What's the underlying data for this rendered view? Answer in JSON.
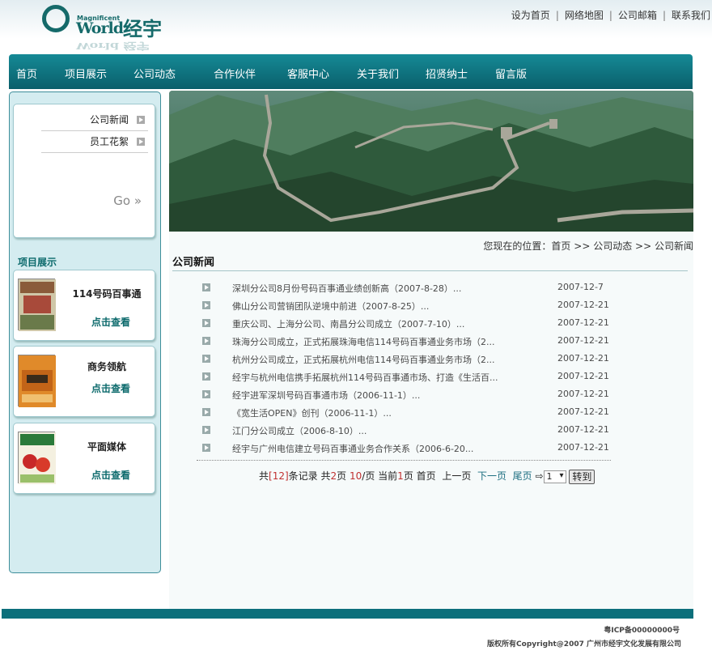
{
  "logo": {
    "small": "Magnificent",
    "world": "World",
    "cn": "经宇",
    "reflect": "World 经宇"
  },
  "toplinks": [
    "设为首页",
    "网络地图",
    "公司邮箱",
    "联系我们"
  ],
  "nav": [
    "首页",
    "项目展示",
    "公司动态",
    "合作伙伴",
    "客服中心",
    "关于我们",
    "招贤纳士",
    "留言版"
  ],
  "sidebar": {
    "subnav": [
      "公司新闻",
      "员工花絮"
    ],
    "go": "Go »",
    "title": "项目展示",
    "cards": [
      {
        "title": "114号码百事通",
        "link": "点击查看"
      },
      {
        "title": "商务领航",
        "link": "点击查看"
      },
      {
        "title": "平面媒体",
        "link": "点击查看"
      }
    ]
  },
  "breadcrumb": {
    "prefix": "您现在的位置：",
    "items": [
      "首页",
      "公司动态",
      "公司新闻"
    ],
    "sep": ">>"
  },
  "section_title": "公司新闻",
  "news": [
    {
      "title": "深圳分公司8月份号码百事通业绩创新高（2007-8-28）...",
      "date": "2007-12-7"
    },
    {
      "title": "佛山分公司营销团队逆境中前进（2007-8-25）...",
      "date": "2007-12-21"
    },
    {
      "title": "重庆公司、上海分公司、南昌分公司成立（2007-7-10）...",
      "date": "2007-12-21"
    },
    {
      "title": "珠海分公司成立，正式拓展珠海电信114号码百事通业务市场（2...",
      "date": "2007-12-21"
    },
    {
      "title": "杭州分公司成立，正式拓展杭州电信114号码百事通业务市场（2...",
      "date": "2007-12-21"
    },
    {
      "title": "经宇与杭州电信携手拓展杭州114号码百事通市场、打造《生活百...",
      "date": "2007-12-21"
    },
    {
      "title": "经宇进军深圳号码百事通市场（2006-11-1）...",
      "date": "2007-12-21"
    },
    {
      "title": "《宽生活OPEN》创刊（2006-11-1）...",
      "date": "2007-12-21"
    },
    {
      "title": "江门分公司成立（2006-8-10）...",
      "date": "2007-12-21"
    },
    {
      "title": "经宇与广州电信建立号码百事通业务合作关系（2006-6-20...",
      "date": "2007-12-21"
    }
  ],
  "pager": {
    "total_pre": "共",
    "total": "[12]",
    "total_post": "条记录",
    "pages_pre": "共",
    "pages": "2",
    "pages_post": "页",
    "per_page": "10",
    "per_page_post": "/页",
    "current_pre": "当前",
    "current": "1",
    "current_post": "页",
    "first": "首页",
    "prev": "上一页",
    "next": "下一页",
    "last": "尾页",
    "select_value": "1",
    "go_label": "转到"
  },
  "footer": {
    "icp": "粤ICP备00000000号",
    "copyright": "版权所有Copyright@2007  广州市经宇文化发展有限公司"
  },
  "colors": {
    "primary": "#0c6f7b",
    "nav_top": "#158a96",
    "sidebar_bg": "#d4ecf0"
  }
}
